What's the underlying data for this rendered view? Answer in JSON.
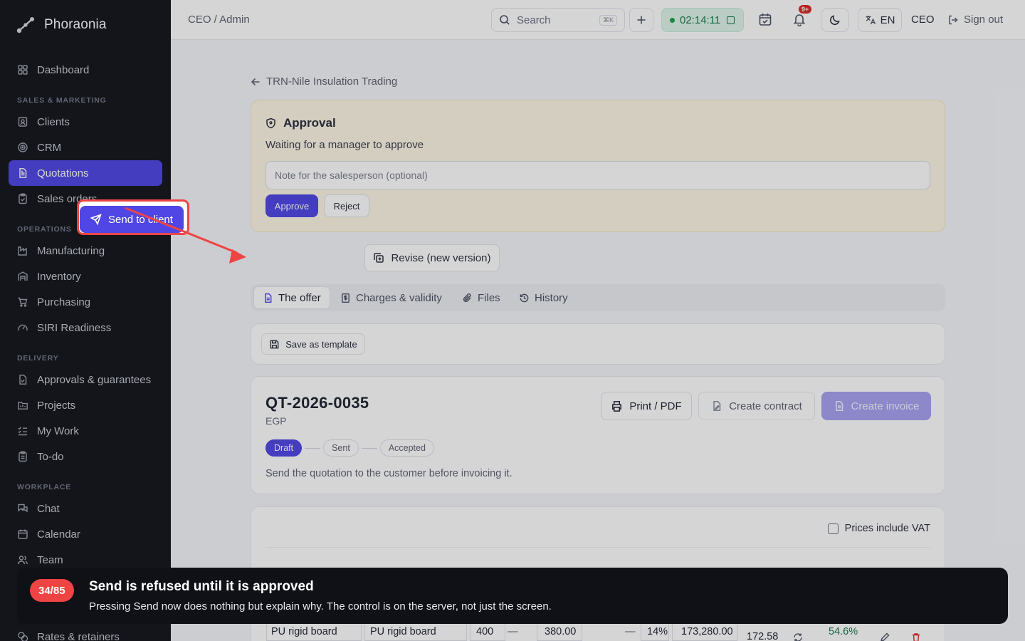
{
  "brand": {
    "name": "Phoraonia"
  },
  "sidebar": {
    "dashboard": "Dashboard",
    "sections": {
      "sales": "SALES & MARKETING",
      "operations": "OPERATIONS",
      "delivery": "DELIVERY",
      "workplace": "WORKPLACE"
    },
    "items": {
      "clients": "Clients",
      "crm": "CRM",
      "quotations": "Quotations",
      "sales_orders": "Sales orders",
      "manufacturing": "Manufacturing",
      "inventory": "Inventory",
      "purchasing": "Purchasing",
      "siri": "SIRI Readiness",
      "approvals": "Approvals & guarantees",
      "projects": "Projects",
      "my_work": "My Work",
      "todo": "To-do",
      "chat": "Chat",
      "calendar": "Calendar",
      "team": "Team",
      "rates": "Rates & retainers"
    },
    "active": "quotations"
  },
  "topbar": {
    "breadcrumb": "CEO / Admin",
    "search_placeholder": "Search",
    "search_shortcut": "⌘K",
    "timer": "02:14:11",
    "notifications_badge": "9+",
    "language": "EN",
    "role": "CEO",
    "sign_out": "Sign out"
  },
  "page": {
    "back_label": "TRN-Nile Insulation Trading",
    "approval": {
      "title": "Approval",
      "subtitle": "Waiting for a manager to approve",
      "note_placeholder": "Note for the salesperson (optional)",
      "approve": "Approve",
      "reject": "Reject"
    },
    "actions": {
      "send_to_client": "Send to client",
      "revise": "Revise (new version)"
    },
    "tabs": [
      "The offer",
      "Charges & validity",
      "Files",
      "History"
    ],
    "active_tab": 0,
    "save_template": "Save as template",
    "quote": {
      "number": "QT-2026-0035",
      "currency": "EGP",
      "print": "Print / PDF",
      "create_contract": "Create contract",
      "create_invoice": "Create invoice",
      "statuses": [
        "Draft",
        "Sent",
        "Accepted"
      ],
      "current_status": 0,
      "hint": "Send the quotation to the customer before invoicing it."
    },
    "items": {
      "prices_include_vat": "Prices include VAT",
      "row": {
        "product": "PU rigid board",
        "description": "PU rigid board",
        "qty": "400",
        "unit_dash": "—",
        "price": "380.00",
        "discount_dash": "—",
        "vat": "14%",
        "total": "173,280.00",
        "cost": "172.58",
        "margin": "54.6%"
      }
    }
  },
  "tour": {
    "step": "34/85",
    "title": "Send is refused until it is approved",
    "text": "Pressing Send now does nothing but explain why. The control is on the server, not just the screen."
  },
  "colors": {
    "primary": "#4f46e5",
    "highlight": "#ef4444",
    "sidebar_bg": "#13151c",
    "approval_bg": "#fdf7e4",
    "timer_bg": "#dff5e8",
    "margin_green": "#16794a"
  }
}
